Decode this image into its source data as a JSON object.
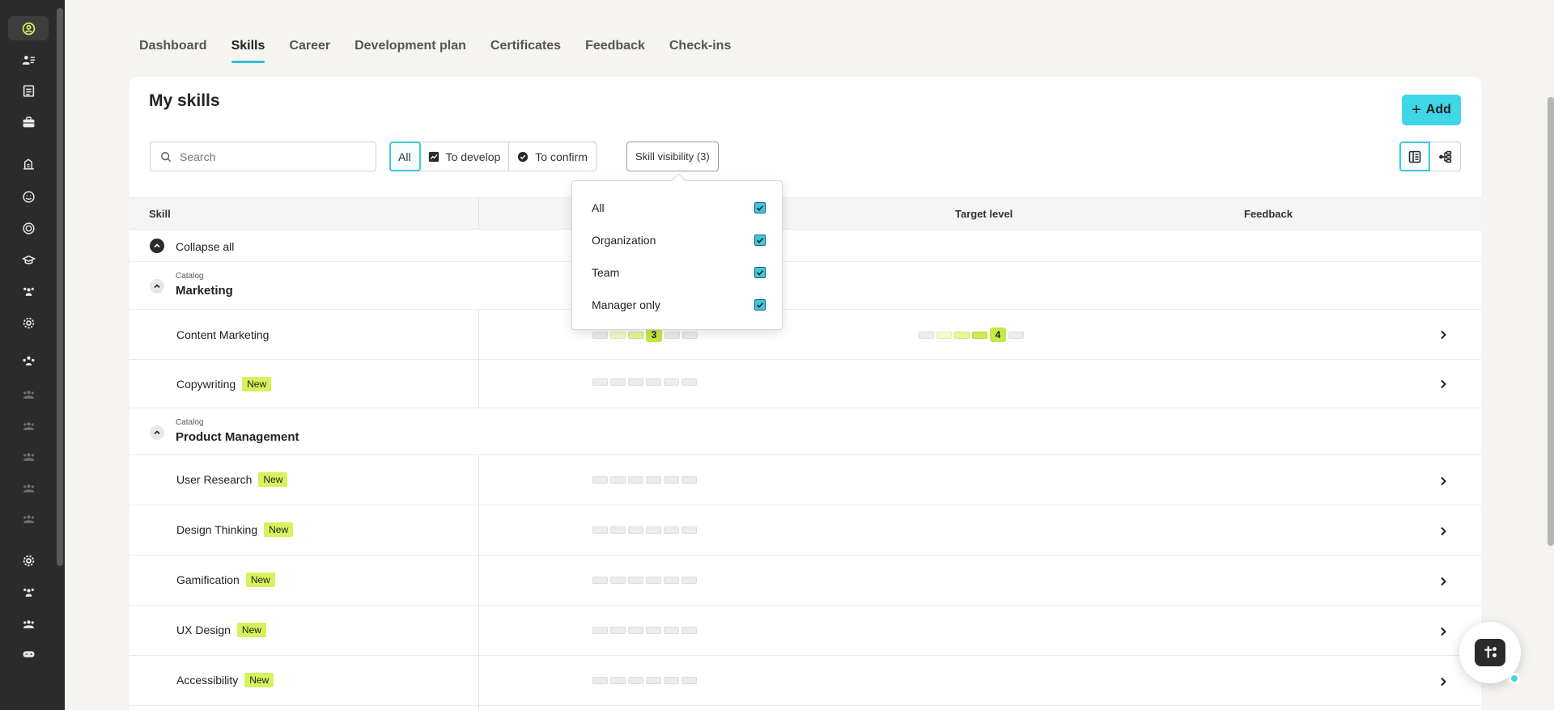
{
  "tabs": [
    {
      "label": "Dashboard"
    },
    {
      "label": "Skills"
    },
    {
      "label": "Career"
    },
    {
      "label": "Development plan"
    },
    {
      "label": "Certificates"
    },
    {
      "label": "Feedback"
    },
    {
      "label": "Check-ins"
    }
  ],
  "active_tab": "Skills",
  "page": {
    "title": "My skills",
    "add_label": "Add",
    "search_placeholder": "Search",
    "filters": [
      {
        "label": "All",
        "icon": "none"
      },
      {
        "label": "To develop",
        "icon": "trend-up-icon"
      },
      {
        "label": "To confirm",
        "icon": "check-circle-icon"
      }
    ],
    "active_filter": "All",
    "visibility_label": "Skill visibility (3)"
  },
  "visibility_dropdown": {
    "options": [
      {
        "label": "All",
        "checked": true
      },
      {
        "label": "Organization",
        "checked": true
      },
      {
        "label": "Team",
        "checked": true
      },
      {
        "label": "Manager only",
        "checked": true
      }
    ]
  },
  "table": {
    "columns": {
      "skill": "Skill",
      "target": "Target level",
      "feedback": "Feedback"
    },
    "collapse_label": "Collapse all",
    "new_badge": "New",
    "groups": [
      {
        "caption": "Catalog",
        "name": "Marketing",
        "skills": [
          {
            "name": "Content Marketing",
            "is_new": false,
            "current_level": 3,
            "target_level": 4
          },
          {
            "name": "Copywriting",
            "is_new": true,
            "current_level": 0,
            "target_level": null
          }
        ]
      },
      {
        "caption": "Catalog",
        "name": "Product Management",
        "skills": [
          {
            "name": "User Research",
            "is_new": true,
            "current_level": 0,
            "target_level": null
          },
          {
            "name": "Design Thinking",
            "is_new": true,
            "current_level": 0,
            "target_level": null
          },
          {
            "name": "Gamification",
            "is_new": true,
            "current_level": 0,
            "target_level": null
          },
          {
            "name": "UX Design",
            "is_new": true,
            "current_level": 0,
            "target_level": null
          },
          {
            "name": "Accessibility",
            "is_new": true,
            "current_level": 0,
            "target_level": null
          }
        ]
      }
    ]
  },
  "colors": {
    "accent": "#3fd6e6",
    "sidebar": "#2b2b2b",
    "new_badge": "#d6f25c"
  }
}
